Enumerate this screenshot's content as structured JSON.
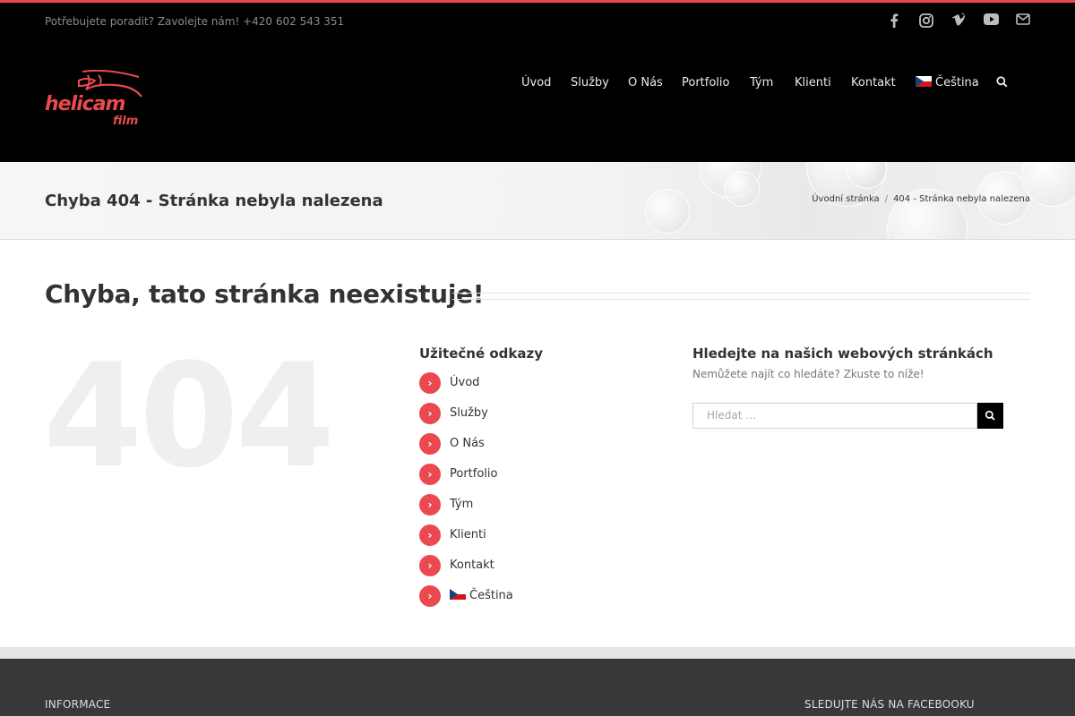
{
  "topbar": {
    "contact_text": "Potřebujete poradit? Zavolejte nám! +420 602 543 351",
    "social_icons": [
      "facebook-icon",
      "instagram-icon",
      "vimeo-icon",
      "youtube-icon",
      "email-icon"
    ]
  },
  "logo": {
    "word1": "helicam",
    "word2": "film"
  },
  "nav": {
    "items": [
      "Úvod",
      "Služby",
      "O Nás",
      "Portfolio",
      "Tým",
      "Klienti",
      "Kontakt",
      "Čeština"
    ],
    "search_icon": "search-icon"
  },
  "titlebar": {
    "title": "Chyba 404 - Stránka nebyla nalezena",
    "breadcrumb_home": "Úvodní stránka",
    "breadcrumb_sep": "/",
    "breadcrumb_current": "404 - Stránka nebyla nalezena"
  },
  "main": {
    "heading": "Chyba, tato stránka neexistuje!",
    "big_number": "404",
    "links_heading": "Užitečné odkazy",
    "links": [
      "Úvod",
      "Služby",
      "O Nás",
      "Portfolio",
      "Tým",
      "Klienti",
      "Kontakt",
      "Čeština"
    ],
    "search_heading": "Hledejte na našich webových stránkách",
    "search_sub": "Nemůžete najít co hledáte? Zkuste to níže!",
    "search_placeholder": "Hledat …"
  },
  "footer": {
    "left_heading": "INFORMACE",
    "right_heading": "SLEDUJTE NÁS NA FACEBOOKU"
  },
  "colors": {
    "accent": "#e9494f",
    "header_bg": "#000000",
    "footer_bg": "#363839"
  }
}
